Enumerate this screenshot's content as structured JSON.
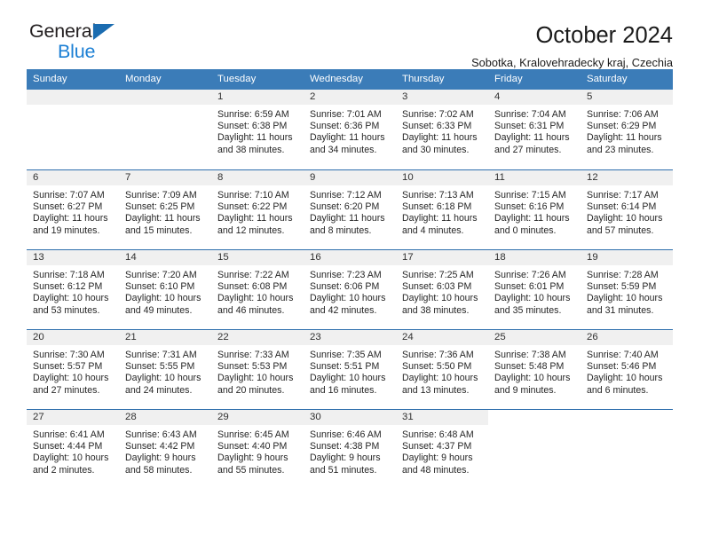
{
  "brand": {
    "name_part1": "General",
    "name_part2": "Blue",
    "triangle_color": "#1b6cb0",
    "blue_color": "#1b7fd4"
  },
  "header": {
    "title": "October 2024",
    "subtitle": "Sobotka, Kralovehradecky kraj, Czechia"
  },
  "theme": {
    "header_bg": "#3b7cb8",
    "week_divider": "#2f6fad",
    "daynum_band": "#f0f0f0"
  },
  "weekdays": [
    "Sunday",
    "Monday",
    "Tuesday",
    "Wednesday",
    "Thursday",
    "Friday",
    "Saturday"
  ],
  "labels": {
    "sunrise": "Sunrise:",
    "sunset": "Sunset:",
    "daylight": "Daylight:"
  },
  "weeks": [
    [
      {
        "day": "",
        "empty": true
      },
      {
        "day": "",
        "empty": true
      },
      {
        "day": "1",
        "sunrise": "Sunrise: 6:59 AM",
        "sunset": "Sunset: 6:38 PM",
        "daylight": "Daylight: 11 hours and 38 minutes."
      },
      {
        "day": "2",
        "sunrise": "Sunrise: 7:01 AM",
        "sunset": "Sunset: 6:36 PM",
        "daylight": "Daylight: 11 hours and 34 minutes."
      },
      {
        "day": "3",
        "sunrise": "Sunrise: 7:02 AM",
        "sunset": "Sunset: 6:33 PM",
        "daylight": "Daylight: 11 hours and 30 minutes."
      },
      {
        "day": "4",
        "sunrise": "Sunrise: 7:04 AM",
        "sunset": "Sunset: 6:31 PM",
        "daylight": "Daylight: 11 hours and 27 minutes."
      },
      {
        "day": "5",
        "sunrise": "Sunrise: 7:06 AM",
        "sunset": "Sunset: 6:29 PM",
        "daylight": "Daylight: 11 hours and 23 minutes."
      }
    ],
    [
      {
        "day": "6",
        "sunrise": "Sunrise: 7:07 AM",
        "sunset": "Sunset: 6:27 PM",
        "daylight": "Daylight: 11 hours and 19 minutes."
      },
      {
        "day": "7",
        "sunrise": "Sunrise: 7:09 AM",
        "sunset": "Sunset: 6:25 PM",
        "daylight": "Daylight: 11 hours and 15 minutes."
      },
      {
        "day": "8",
        "sunrise": "Sunrise: 7:10 AM",
        "sunset": "Sunset: 6:22 PM",
        "daylight": "Daylight: 11 hours and 12 minutes."
      },
      {
        "day": "9",
        "sunrise": "Sunrise: 7:12 AM",
        "sunset": "Sunset: 6:20 PM",
        "daylight": "Daylight: 11 hours and 8 minutes."
      },
      {
        "day": "10",
        "sunrise": "Sunrise: 7:13 AM",
        "sunset": "Sunset: 6:18 PM",
        "daylight": "Daylight: 11 hours and 4 minutes."
      },
      {
        "day": "11",
        "sunrise": "Sunrise: 7:15 AM",
        "sunset": "Sunset: 6:16 PM",
        "daylight": "Daylight: 11 hours and 0 minutes."
      },
      {
        "day": "12",
        "sunrise": "Sunrise: 7:17 AM",
        "sunset": "Sunset: 6:14 PM",
        "daylight": "Daylight: 10 hours and 57 minutes."
      }
    ],
    [
      {
        "day": "13",
        "sunrise": "Sunrise: 7:18 AM",
        "sunset": "Sunset: 6:12 PM",
        "daylight": "Daylight: 10 hours and 53 minutes."
      },
      {
        "day": "14",
        "sunrise": "Sunrise: 7:20 AM",
        "sunset": "Sunset: 6:10 PM",
        "daylight": "Daylight: 10 hours and 49 minutes."
      },
      {
        "day": "15",
        "sunrise": "Sunrise: 7:22 AM",
        "sunset": "Sunset: 6:08 PM",
        "daylight": "Daylight: 10 hours and 46 minutes."
      },
      {
        "day": "16",
        "sunrise": "Sunrise: 7:23 AM",
        "sunset": "Sunset: 6:06 PM",
        "daylight": "Daylight: 10 hours and 42 minutes."
      },
      {
        "day": "17",
        "sunrise": "Sunrise: 7:25 AM",
        "sunset": "Sunset: 6:03 PM",
        "daylight": "Daylight: 10 hours and 38 minutes."
      },
      {
        "day": "18",
        "sunrise": "Sunrise: 7:26 AM",
        "sunset": "Sunset: 6:01 PM",
        "daylight": "Daylight: 10 hours and 35 minutes."
      },
      {
        "day": "19",
        "sunrise": "Sunrise: 7:28 AM",
        "sunset": "Sunset: 5:59 PM",
        "daylight": "Daylight: 10 hours and 31 minutes."
      }
    ],
    [
      {
        "day": "20",
        "sunrise": "Sunrise: 7:30 AM",
        "sunset": "Sunset: 5:57 PM",
        "daylight": "Daylight: 10 hours and 27 minutes."
      },
      {
        "day": "21",
        "sunrise": "Sunrise: 7:31 AM",
        "sunset": "Sunset: 5:55 PM",
        "daylight": "Daylight: 10 hours and 24 minutes."
      },
      {
        "day": "22",
        "sunrise": "Sunrise: 7:33 AM",
        "sunset": "Sunset: 5:53 PM",
        "daylight": "Daylight: 10 hours and 20 minutes."
      },
      {
        "day": "23",
        "sunrise": "Sunrise: 7:35 AM",
        "sunset": "Sunset: 5:51 PM",
        "daylight": "Daylight: 10 hours and 16 minutes."
      },
      {
        "day": "24",
        "sunrise": "Sunrise: 7:36 AM",
        "sunset": "Sunset: 5:50 PM",
        "daylight": "Daylight: 10 hours and 13 minutes."
      },
      {
        "day": "25",
        "sunrise": "Sunrise: 7:38 AM",
        "sunset": "Sunset: 5:48 PM",
        "daylight": "Daylight: 10 hours and 9 minutes."
      },
      {
        "day": "26",
        "sunrise": "Sunrise: 7:40 AM",
        "sunset": "Sunset: 5:46 PM",
        "daylight": "Daylight: 10 hours and 6 minutes."
      }
    ],
    [
      {
        "day": "27",
        "sunrise": "Sunrise: 6:41 AM",
        "sunset": "Sunset: 4:44 PM",
        "daylight": "Daylight: 10 hours and 2 minutes."
      },
      {
        "day": "28",
        "sunrise": "Sunrise: 6:43 AM",
        "sunset": "Sunset: 4:42 PM",
        "daylight": "Daylight: 9 hours and 58 minutes."
      },
      {
        "day": "29",
        "sunrise": "Sunrise: 6:45 AM",
        "sunset": "Sunset: 4:40 PM",
        "daylight": "Daylight: 9 hours and 55 minutes."
      },
      {
        "day": "30",
        "sunrise": "Sunrise: 6:46 AM",
        "sunset": "Sunset: 4:38 PM",
        "daylight": "Daylight: 9 hours and 51 minutes."
      },
      {
        "day": "31",
        "sunrise": "Sunrise: 6:48 AM",
        "sunset": "Sunset: 4:37 PM",
        "daylight": "Daylight: 9 hours and 48 minutes."
      },
      {
        "day": "",
        "empty": true
      },
      {
        "day": "",
        "empty": true
      }
    ]
  ]
}
